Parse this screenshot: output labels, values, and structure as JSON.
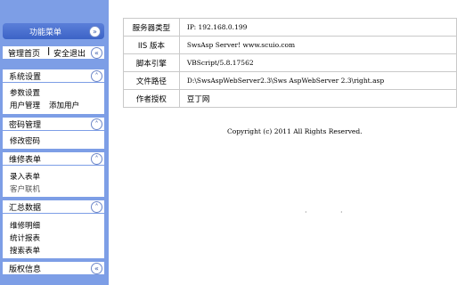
{
  "sidebar": {
    "menu_button": "功能菜单",
    "menu_icon": "double-chevron-down-icon",
    "nav": {
      "home": "管理首页",
      "sep": "|",
      "logout": "安全退出"
    },
    "sections": [
      {
        "title": "系统设置",
        "icon": "double-chevron-up-icon",
        "items": [
          "参数设置",
          "用户管理",
          "添加用户"
        ]
      },
      {
        "title": "密码管理",
        "icon": "double-chevron-up-icon",
        "items": [
          "修改密码"
        ]
      },
      {
        "title": "维修表单",
        "icon": "double-chevron-up-icon",
        "items": [
          "录入表单",
          "客户联机"
        ]
      },
      {
        "title": "汇总数据",
        "icon": "double-chevron-up-icon",
        "items": [
          "维修明细",
          "统计报表",
          "搜索表单"
        ]
      },
      {
        "title": "版权信息",
        "icon": "double-chevron-left-icon",
        "items": []
      }
    ]
  },
  "main": {
    "rows": [
      {
        "key": "服务器类型",
        "value": "IP: 192.168.0.199"
      },
      {
        "key": "IIS 版本",
        "value": "SwsAsp Server! www.scuio.com"
      },
      {
        "key": "脚本引擎",
        "value": "VBScript/5.8.17562"
      },
      {
        "key": "文件路径",
        "value": "D:\\SwsAspWebServer2.3\\Sws AspWebServer 2.3\\right.asp"
      },
      {
        "key": "作者授权",
        "value": "豆丁网"
      }
    ],
    "copyright": "Copyright (c) 2011 All Rights Reserved."
  }
}
